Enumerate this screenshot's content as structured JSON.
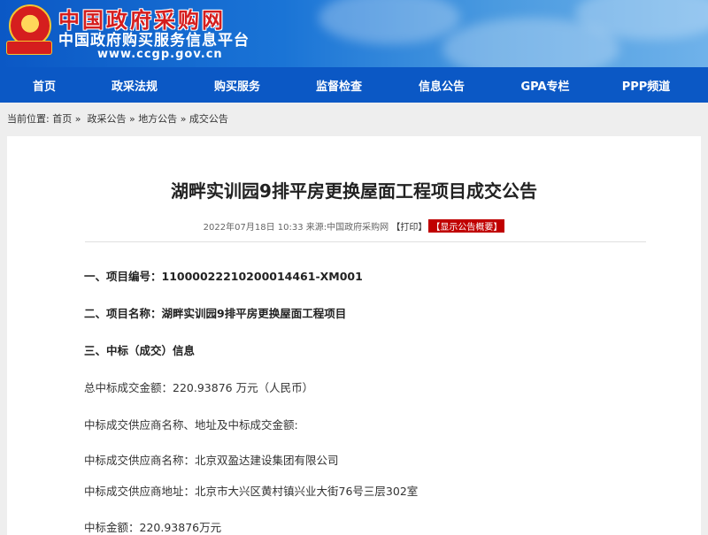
{
  "header": {
    "site_name": "中国政府采购网",
    "site_subtitle": "中国政府购买服务信息平台",
    "site_url": "www.ccgp.gov.cn"
  },
  "nav": {
    "items": [
      {
        "label": "首页"
      },
      {
        "label": "政采法规"
      },
      {
        "label": "购买服务"
      },
      {
        "label": "监督检查"
      },
      {
        "label": "信息公告"
      },
      {
        "label": "GPA专栏"
      },
      {
        "label": "PPP频道"
      }
    ]
  },
  "breadcrumb": {
    "prefix": "当前位置:",
    "items": [
      "首页",
      "政采公告",
      "地方公告",
      "成交公告"
    ],
    "separator": "»"
  },
  "article": {
    "title": "湖畔实训园9排平房更换屋面工程项目成交公告",
    "date": "2022年07月18日 10:33",
    "source_label": "来源:",
    "source": "中国政府采购网",
    "print_label": "【打印】",
    "summary_label": "【显示公告概要】",
    "lines": [
      "一、项目编号：11000022210200014461-XM001",
      "二、项目名称：湖畔实训园9排平房更换屋面工程项目",
      "三、中标（成交）信息",
      "总中标成交金额：220.93876 万元（人民币）",
      "中标成交供应商名称、地址及中标成交金额:",
      "中标成交供应商名称：北京双盈达建设集团有限公司",
      "中标成交供应商地址：北京市大兴区黄村镇兴业大街76号三层302室",
      "中标金额：220.93876万元"
    ]
  },
  "colors": {
    "nav_bg": "#0b58c5",
    "title_red": "#d51e1e",
    "summary_badge": "#c00000"
  }
}
